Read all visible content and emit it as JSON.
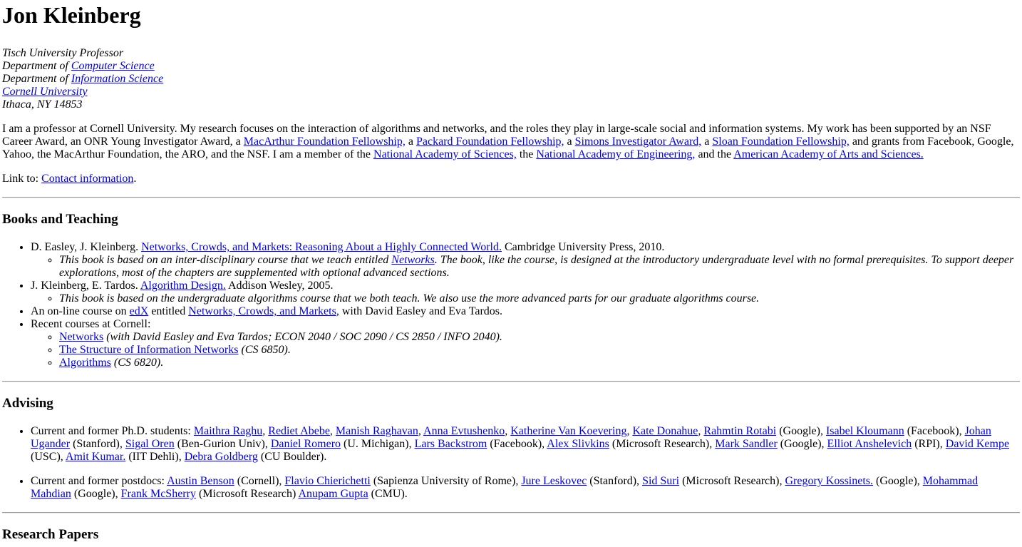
{
  "name": "Jon Kleinberg",
  "title_lines": {
    "professor": "Tisch University Professor",
    "dept_prefix": "Department of",
    "cs": "Computer Science",
    "is": "Information Science",
    "cornell": "Cornell University",
    "city": "Ithaca, NY 14853"
  },
  "bio": {
    "t1": "I am a professor at Cornell University. My research focuses on the interaction of algorithms and networks, and the roles they play in large-scale social and information systems. My work has been supported by an NSF Career Award, an ONR Young Investigator Award, a ",
    "macarthur": "MacArthur Foundation Fellowship,",
    "t2": " a ",
    "packard": "Packard Foundation Fellowship,",
    "t3": " a ",
    "simons": "Simons Investigator Award,",
    "t4": " a ",
    "sloan": "Sloan Foundation Fellowship,",
    "t5": " and grants from Facebook, Google, Yahoo, the MacArthur Foundation, the ARO, and the NSF. I am a member of the ",
    "nas": "National Academy of Sciences,",
    "t6": " the ",
    "nae": "National Academy of Engineering,",
    "t7": " and the ",
    "aaas": "American Academy of Arts and Sciences.",
    "link_prefix": "Link to: ",
    "contact": "Contact information",
    "link_suffix": "."
  },
  "books": {
    "heading": "Books and Teaching",
    "b1_pre": "D. Easley, J. Kleinberg. ",
    "b1_link": "Networks, Crowds, and Markets: Reasoning About a Highly Connected World.",
    "b1_post": " Cambridge University Press, 2010.",
    "b1_note_pre": "This book is based on an inter-disciplinary course that we teach entitled ",
    "b1_note_link": "Networks",
    "b1_note_post": ". The book, like the course, is designed at the introductory undergraduate level with no formal prerequisites. To support deeper explorations, most of the chapters are supplemented with optional advanced sections.",
    "b2_pre": "J. Kleinberg, E. Tardos. ",
    "b2_link": "Algorithm Design.",
    "b2_post": " Addison Wesley, 2005.",
    "b2_note": "This book is based on the undergraduate algorithms course that we both teach. We also use the more advanced parts for our graduate algorithms course.",
    "c1_pre": "An on-line course on ",
    "c1_edx": "edX",
    "c1_mid": " entitled ",
    "c1_link": "Networks, Crowds, and Markets",
    "c1_post": ", with David Easley and Eva Tardos.",
    "recent": "Recent courses at Cornell:",
    "r1_link": "Networks",
    "r1_note": " (with David Easley and Eva Tardos; ECON 2040 / SOC 2090 / CS 2850 / INFO 2040).",
    "r2_link": "The Structure of Information Networks",
    "r2_note": " (CS 6850).",
    "r3_link": "Algorithms",
    "r3_note": " (CS 6820)."
  },
  "advising": {
    "heading": "Advising",
    "phd_label": "Current and former Ph.D. students: ",
    "phd": [
      {
        "name": "Maithra Raghu",
        "after": ", "
      },
      {
        "name": "Rediet Abebe",
        "after": ", "
      },
      {
        "name": "Manish Raghavan",
        "after": ", "
      },
      {
        "name": "Anna Evtushenko",
        "after": ", "
      },
      {
        "name": "Katherine Van Koevering",
        "after": ", "
      },
      {
        "name": "Kate Donahue",
        "after": ", "
      },
      {
        "name": "Rahmtin Rotabi",
        "after": " (Google), "
      },
      {
        "name": "Isabel Kloumann",
        "after": " (Facebook), "
      },
      {
        "name": "Johan Ugander",
        "after": " (Stanford), "
      },
      {
        "name": "Sigal Oren",
        "after": " (Ben-Gurion Univ), "
      },
      {
        "name": "Daniel Romero",
        "after": " (U. Michigan), "
      },
      {
        "name": "Lars Backstrom",
        "after": " (Facebook), "
      },
      {
        "name": "Alex Slivkins",
        "after": " (Microsoft Research), "
      },
      {
        "name": "Mark Sandler",
        "after": " (Google), "
      },
      {
        "name": "Elliot Anshelevich",
        "after": " (RPI), "
      },
      {
        "name": "David Kempe",
        "after": " (USC), "
      },
      {
        "name": "Amit Kumar.",
        "after": " (IIT Dehli), "
      },
      {
        "name": "Debra Goldberg",
        "after": " (CU Boulder)."
      }
    ],
    "postdoc_label": "Current and former postdocs: ",
    "postdocs": [
      {
        "name": "Austin Benson",
        "after": " (Cornell), "
      },
      {
        "name": "Flavio Chierichetti",
        "after": " (Sapienza University of Rome), "
      },
      {
        "name": "Jure Leskovec",
        "after": " (Stanford), "
      },
      {
        "name": "Sid Suri",
        "after": " (Microsoft Research), "
      },
      {
        "name": "Gregory Kossinets.",
        "after": " (Google), "
      },
      {
        "name": "Mohammad Mahdian",
        "after": " (Google), "
      },
      {
        "name": "Frank McSherry",
        "after": " (Microsoft Research) "
      },
      {
        "name": "Anupam Gupta",
        "after": " (CMU)."
      }
    ]
  },
  "papers": {
    "heading": "Research Papers"
  },
  "colors": {
    "link": "#0000ee",
    "text": "#000000",
    "rule": "#9a9a9a"
  }
}
